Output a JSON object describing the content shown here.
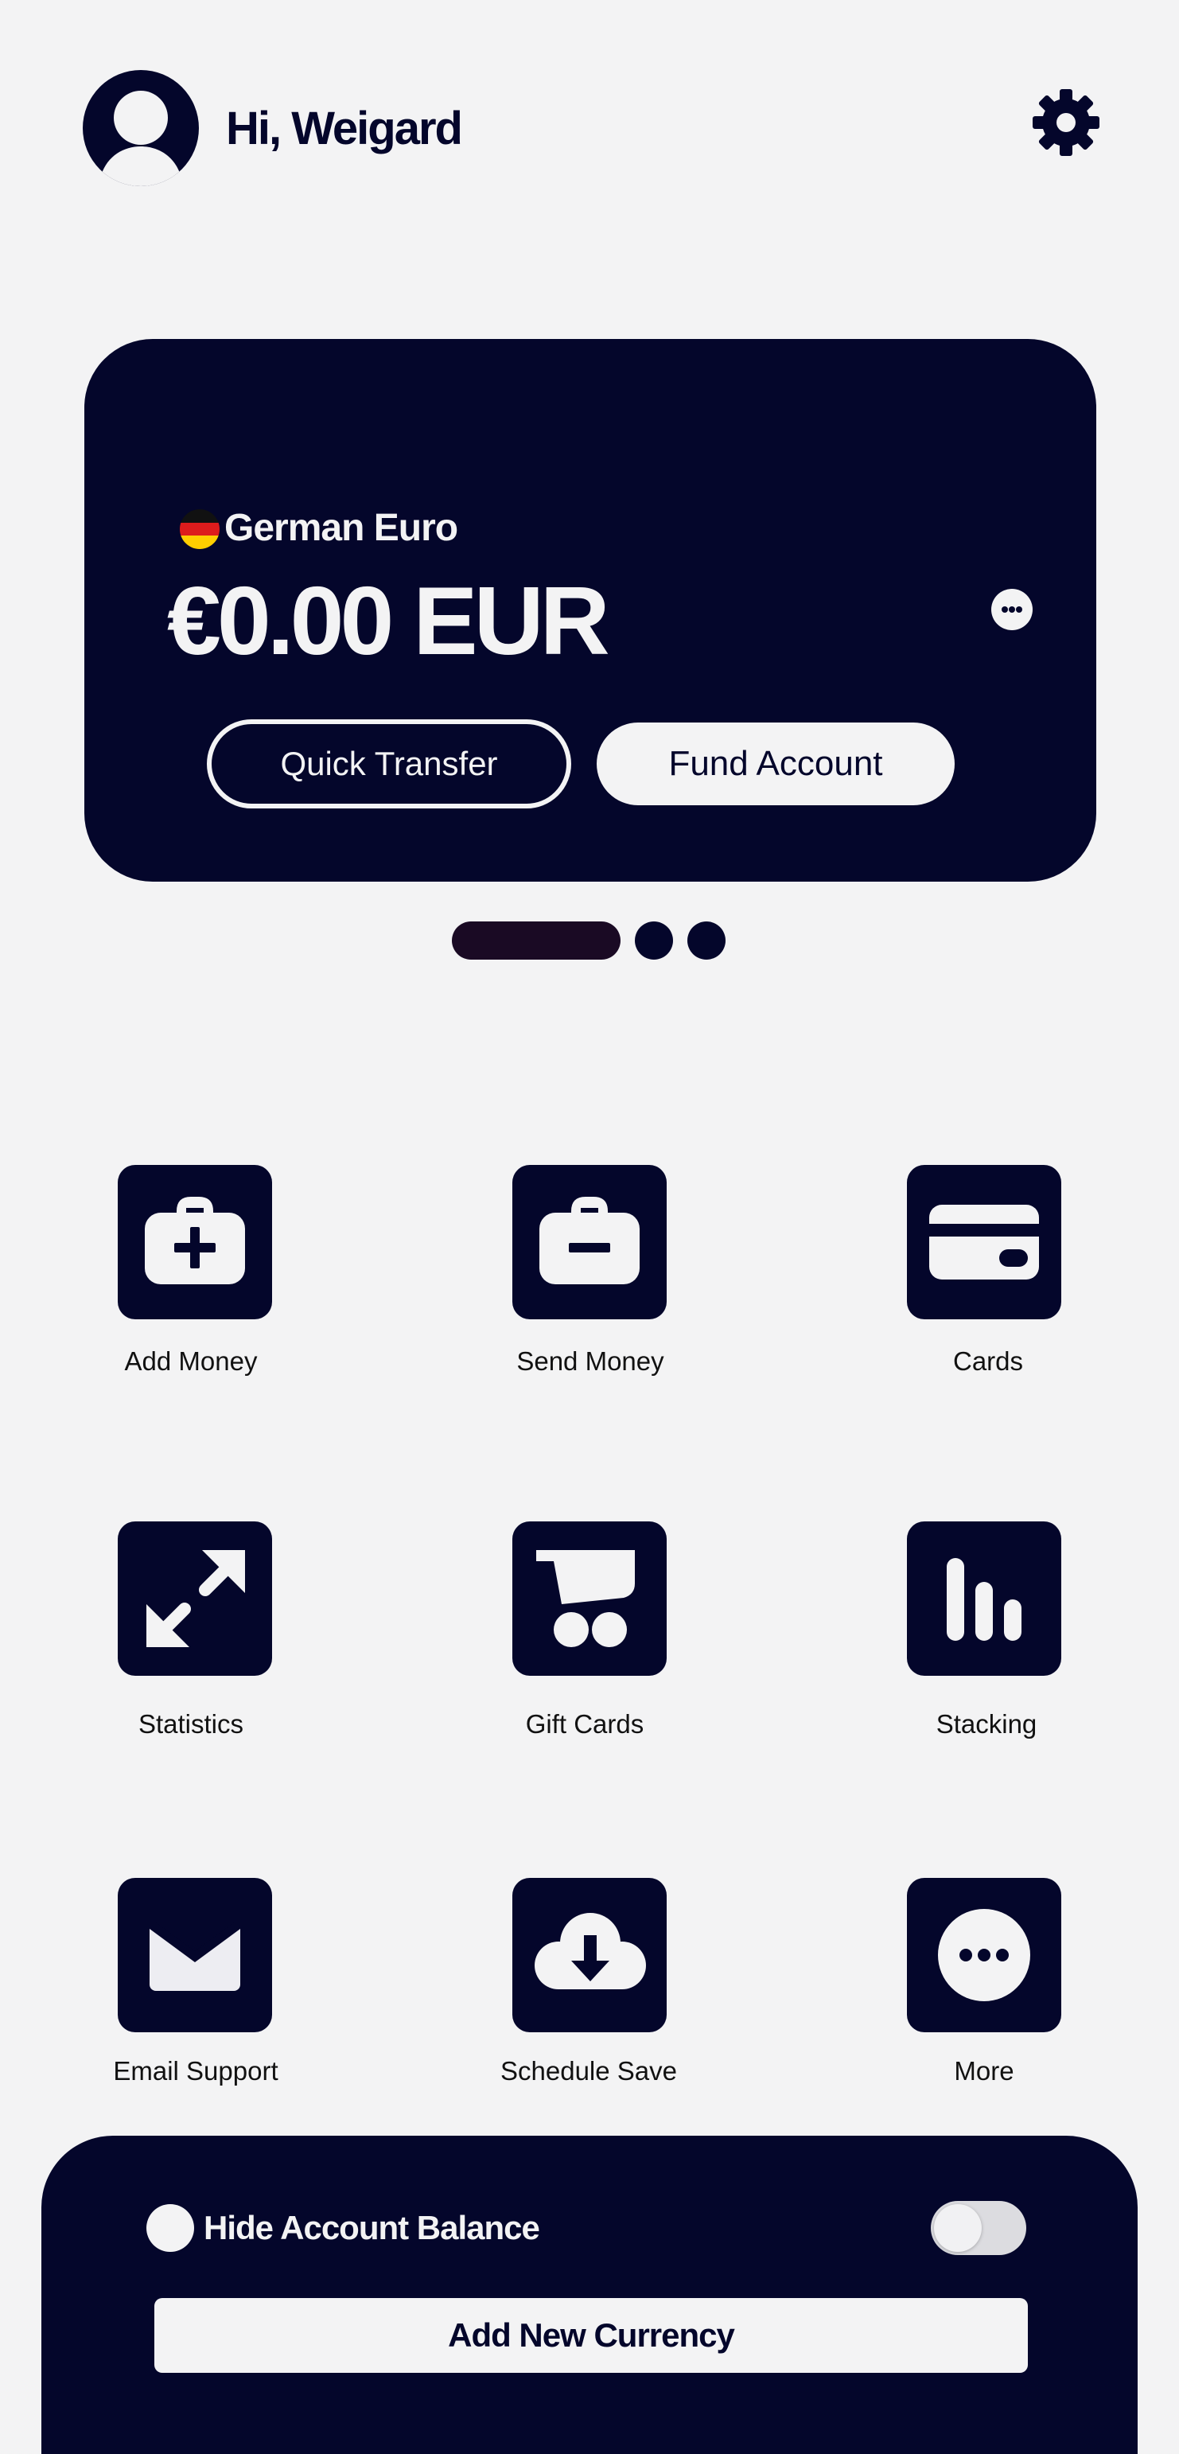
{
  "header": {
    "greeting": "Hi, Weigard"
  },
  "balance_card": {
    "currency_name": "German Euro",
    "balance": "€0.00 EUR",
    "quick_transfer_label": "Quick Transfer",
    "fund_account_label": "Fund Account"
  },
  "carousel": {
    "total_pages": 3,
    "active_page": 1
  },
  "actions": [
    {
      "label": "Add Money",
      "icon": "add-money-icon"
    },
    {
      "label": "Send Money",
      "icon": "send-money-icon"
    },
    {
      "label": "Cards",
      "icon": "card-icon"
    },
    {
      "label": "Statistics",
      "icon": "expand-arrows-icon"
    },
    {
      "label": "Gift Cards",
      "icon": "cart-icon"
    },
    {
      "label": "Stacking",
      "icon": "bar-chart-icon"
    },
    {
      "label": "Email Support",
      "icon": "envelope-icon"
    },
    {
      "label": "Schedule Save",
      "icon": "cloud-download-icon"
    },
    {
      "label": "More",
      "icon": "more-icon"
    }
  ],
  "bottom_sheet": {
    "hide_balance_label": "Hide Account Balance",
    "hide_balance_enabled": false,
    "add_currency_label": "Add New Currency"
  },
  "colors": {
    "primary": "#04062b",
    "background": "#f3f3f4",
    "accent_pill": "#1a0a24"
  }
}
